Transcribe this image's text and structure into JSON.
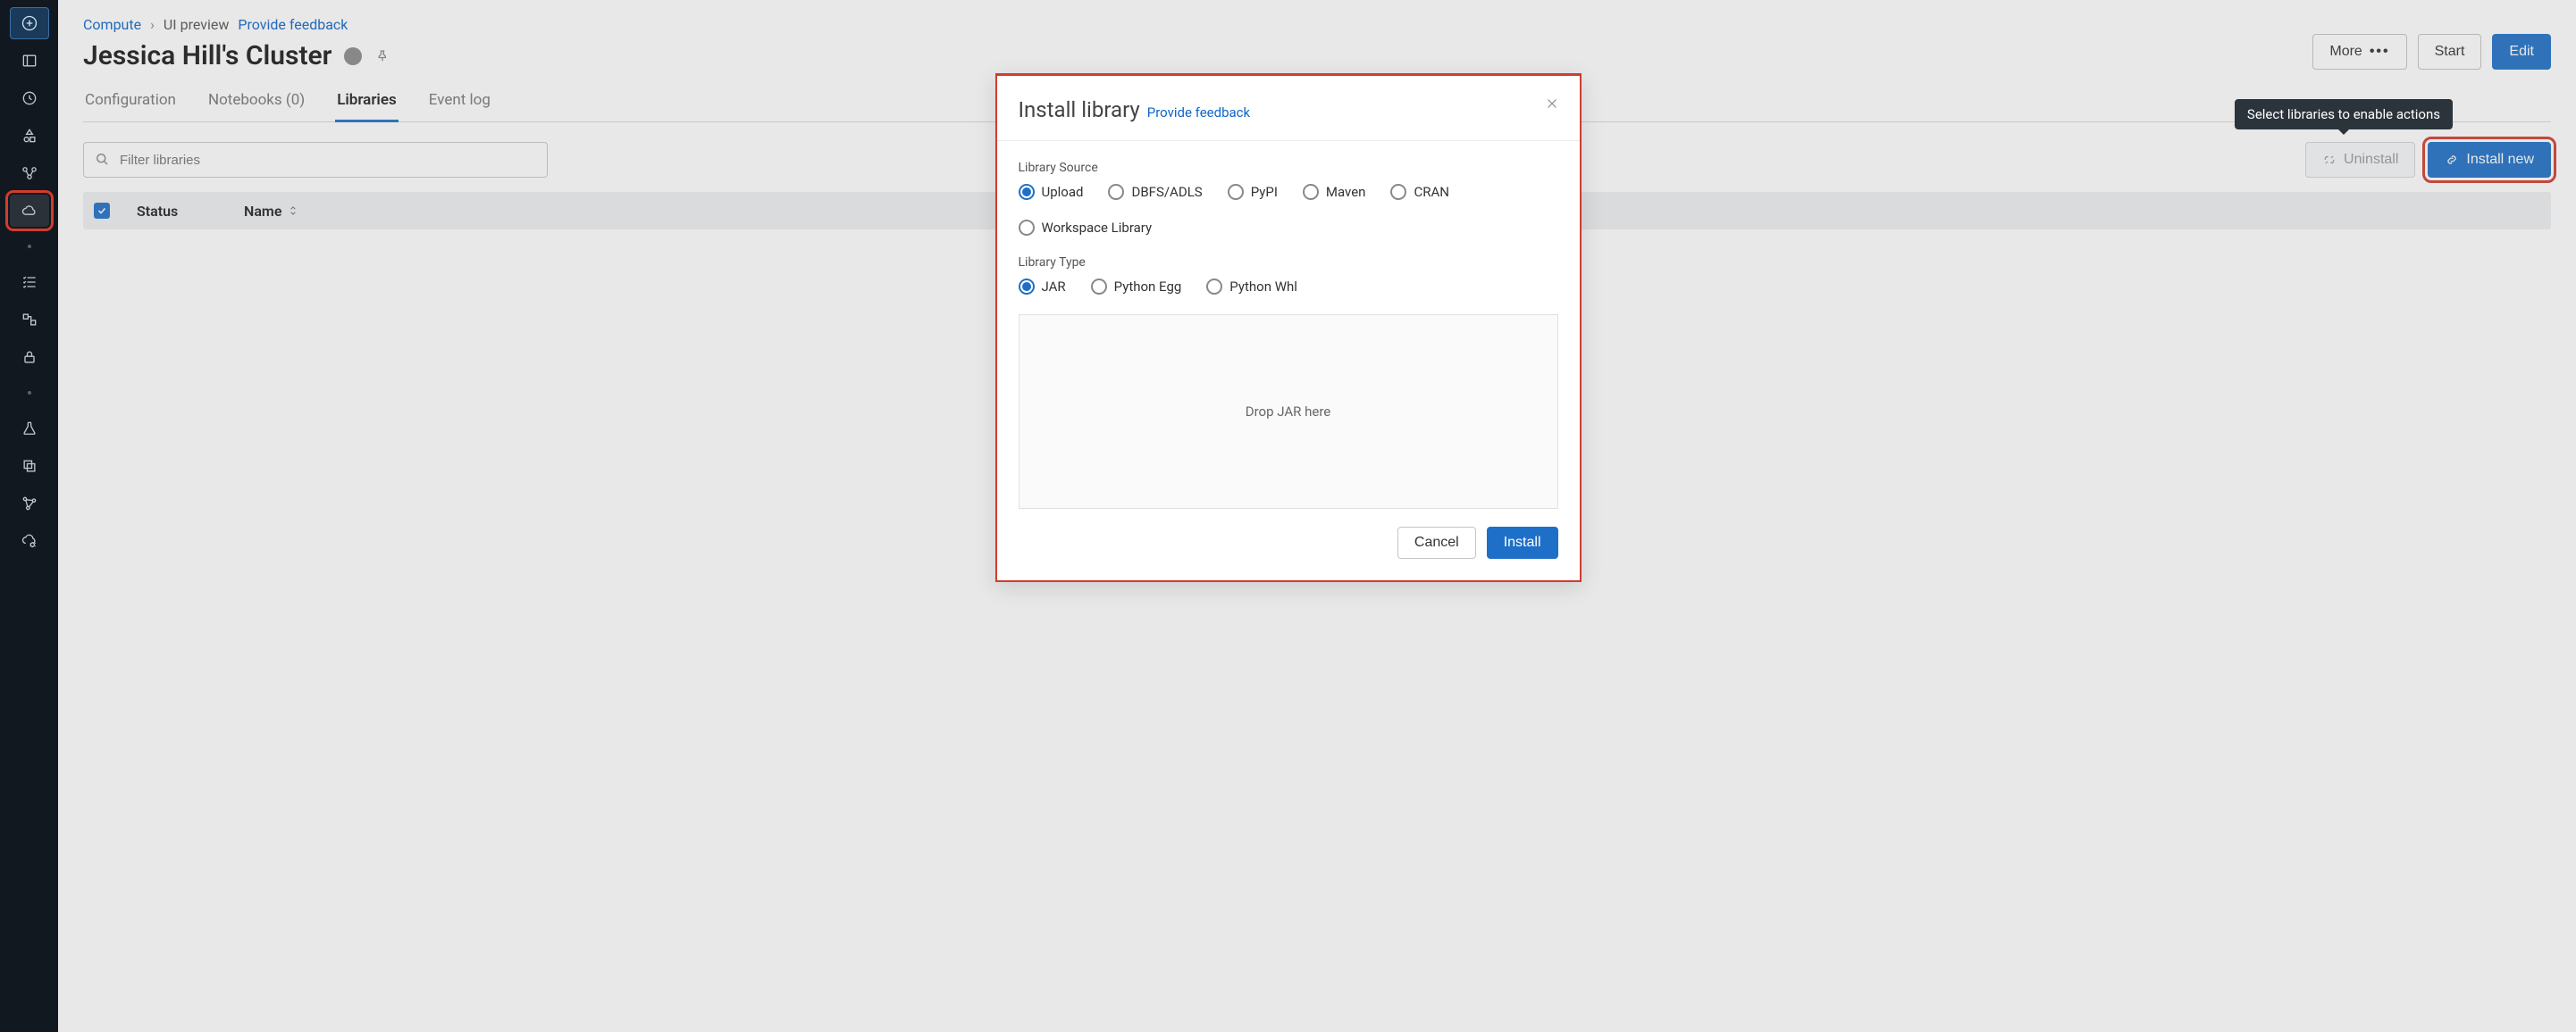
{
  "breadcrumbs": {
    "compute": "Compute",
    "preview": "UI preview",
    "feedback": "Provide feedback"
  },
  "cluster": {
    "title": "Jessica Hill's Cluster"
  },
  "actions": {
    "more": "More",
    "start": "Start",
    "edit": "Edit"
  },
  "tabs": {
    "config": "Configuration",
    "notebooks": "Notebooks (0)",
    "libraries": "Libraries",
    "eventlog": "Event log"
  },
  "search": {
    "placeholder": "Filter libraries"
  },
  "lib_actions": {
    "uninstall": "Uninstall",
    "install": "Install new"
  },
  "tooltip": {
    "uninstall": "Select libraries to enable actions"
  },
  "table": {
    "status_h": "Status",
    "name_h": "Name"
  },
  "modal": {
    "title": "Install library",
    "feedback": "Provide feedback",
    "source_label": "Library Source",
    "sources": {
      "upload": "Upload",
      "dbfs": "DBFS/ADLS",
      "pypi": "PyPI",
      "maven": "Maven",
      "cran": "CRAN",
      "workspace": "Workspace Library"
    },
    "type_label": "Library Type",
    "types": {
      "jar": "JAR",
      "egg": "Python Egg",
      "whl": "Python Whl"
    },
    "dropzone": "Drop JAR here",
    "cancel": "Cancel",
    "install": "Install"
  }
}
